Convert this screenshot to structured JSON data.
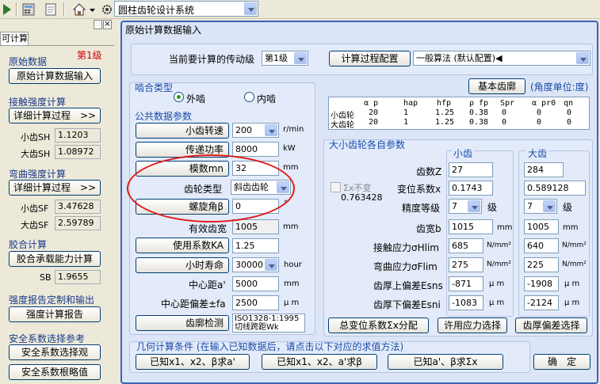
{
  "toolbar": {
    "system_combo": "圆柱齿轮设计系统"
  },
  "left_panel": {
    "top_tab": "可计算",
    "close_button": "×",
    "sections": {
      "original_data": {
        "title": "原始数据",
        "level": "第1级",
        "button": "原始计算数据输入"
      },
      "contact": {
        "title": "接触强度计算",
        "button": "详细计算过程　>>",
        "rows": [
          {
            "label": "小齿SH",
            "value": "1.1203"
          },
          {
            "label": "大齿SH",
            "value": "1.08972"
          }
        ]
      },
      "bending": {
        "title": "弯曲强度计算",
        "button": "详细计算过程　>>",
        "rows": [
          {
            "label": "小齿SF",
            "value": "3.47628"
          },
          {
            "label": "大齿SF",
            "value": "2.59789"
          }
        ]
      },
      "glue": {
        "title": "胶合计算",
        "button": "胶合承载能力计算",
        "label": "SB",
        "value": "1.9655"
      },
      "report": {
        "title": "强度报告定制和输出",
        "button": "强度计算报告"
      },
      "safety": {
        "title": "安全系数选择参考",
        "button1": "安全系数选择观",
        "button2": "安全系数根略值"
      }
    }
  },
  "main": {
    "title": "原始计算数据输入",
    "stage_label": "当前要计算的传动级",
    "stage_value": "第1级",
    "config_button": "计算过程配置",
    "method_value": "一般算法 (默认配置)◀",
    "mesh": {
      "title": "啮合类型",
      "external": "外啮",
      "internal": "内啮"
    },
    "basic_rack_button": "基本齿廓",
    "angle_unit": "(角度单位:度)",
    "rack_table": {
      "headers": [
        "α p",
        "hap",
        "hfp",
        "ρ fp",
        "Spr",
        "α pr0",
        "qn"
      ],
      "rows": [
        {
          "label": "小齿轮",
          "values": [
            "20",
            "1",
            "1.25",
            "0.38",
            "0",
            "0",
            "0"
          ]
        },
        {
          "label": "大齿轮",
          "values": [
            "20",
            "1",
            "1.25",
            "0.38",
            "0",
            "0",
            "0"
          ]
        }
      ]
    },
    "common": {
      "title": "公共数据参数",
      "speed": {
        "button": "小齿转速",
        "value": "200",
        "unit": "r/min"
      },
      "power": {
        "button": "传递功率",
        "value": "8000",
        "unit": "kW"
      },
      "module": {
        "button": "模数mn",
        "value": "32",
        "unit": "mm"
      },
      "gear_type": {
        "label": "齿轮类型",
        "value": "斜齿齿轮"
      },
      "helix": {
        "button": "螺旋角β",
        "value": "0",
        "unit": "°"
      },
      "eff_width": {
        "label": "有效齿宽",
        "value": "1005",
        "unit": "mm"
      },
      "ka": {
        "button": "使用系数KA",
        "value": "1.25"
      },
      "life": {
        "button": "小时寿命",
        "value": "30000",
        "unit": "hour"
      },
      "center": {
        "label": "中心距a'",
        "value": "5000",
        "unit": "mm"
      },
      "center_dev": {
        "label": "中心距偏差±fa",
        "value": "2500",
        "unit": "μ m"
      },
      "inspect": {
        "button": "齿廓检测",
        "value_line1": "ISO1328-1:1995",
        "value_line2": "切线跨距Wk"
      }
    },
    "gears": {
      "title": "大小齿轮各自参数",
      "small_header": "小齿",
      "big_header": "大齿",
      "sum_check": "Σx不变",
      "sum_value": "0.763428",
      "rows": [
        {
          "label": "齿数Z",
          "small": "27",
          "big": "284",
          "unit": ""
        },
        {
          "label": "变位系数x",
          "small": "0.1743",
          "big": "0.589128",
          "unit": ""
        },
        {
          "label": "精度等级",
          "small": "7",
          "big": "7",
          "unit": "级"
        },
        {
          "label": "齿宽b",
          "small": "1015",
          "big": "1005",
          "unit": "mm"
        },
        {
          "label": "接触应力σHlim",
          "small": "685",
          "big": "640",
          "unit": "N/mm²"
        },
        {
          "label": "弯曲应力σFlim",
          "small": "275",
          "big": "225",
          "unit": "N/mm²"
        },
        {
          "label": "齿厚上偏差Esns",
          "small": "-871",
          "big": "-1908",
          "unit": "μ m"
        },
        {
          "label": "齿厚下偏差Esni",
          "small": "-1083",
          "big": "-2124",
          "unit": "μ m"
        }
      ],
      "btn_total_shift": "总变位系数Σx分配",
      "btn_allow_stress": "许用应力选择",
      "btn_thickness": "齿厚偏差选择"
    },
    "geometry": {
      "title": "几何计算条件 (在输入已知数据后，请点击以下对应的求值方法)",
      "btn1": "已知x1、x2、β求a'",
      "btn2": "已知x1、x2、a'求β",
      "btn3": "已知a'、β求Σx",
      "ok": "确　定"
    }
  }
}
